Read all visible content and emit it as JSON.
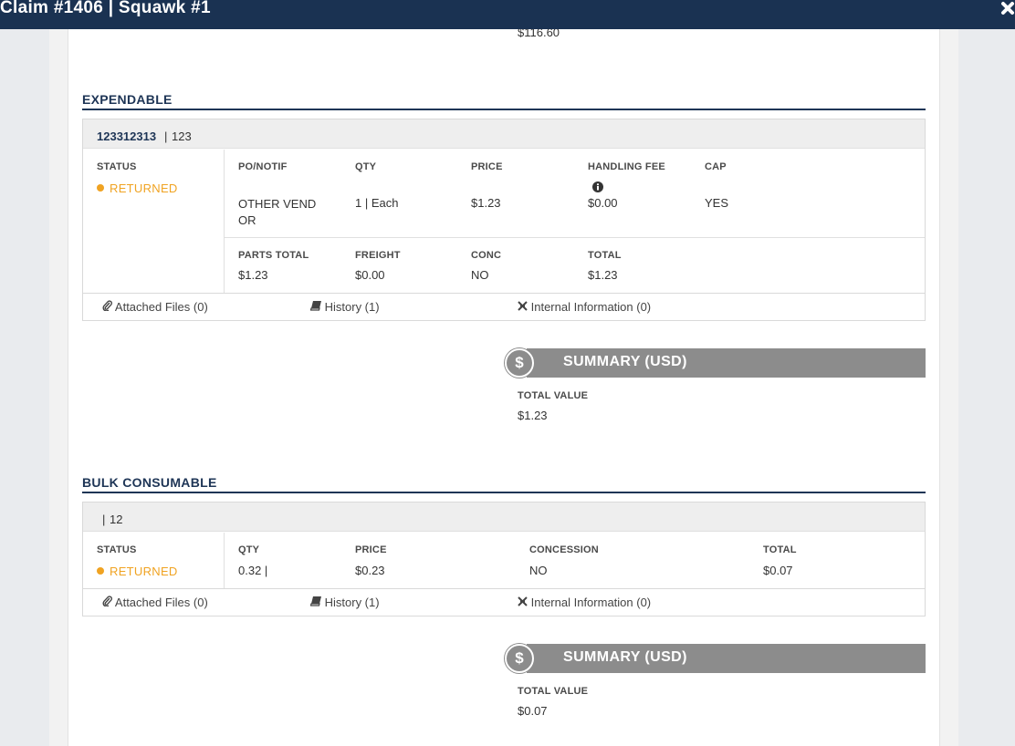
{
  "window": {
    "title": "Claim #1406 | Squawk #1"
  },
  "top_value": "$116.60",
  "sections": [
    {
      "title": "EXPENDABLE",
      "card": {
        "id": "123312313",
        "separator": "|",
        "sub": "123",
        "status_label": "STATUS",
        "status_value": "RETURNED",
        "row1": {
          "po_label": "PO/NOTIF",
          "po_value": "OTHER VENDOR",
          "qty_label": "QTY",
          "qty_value": "1 | Each",
          "price_label": "PRICE",
          "price_value": "$1.23",
          "fee_label": "HANDLING FEE",
          "fee_value": "$0.00",
          "cap_label": "CAP",
          "cap_value": "YES"
        },
        "row2": {
          "parts_label": "PARTS TOTAL",
          "parts_value": "$1.23",
          "freight_label": "FREIGHT",
          "freight_value": "$0.00",
          "conc_label": "CONC",
          "conc_value": "NO",
          "total_label": "TOTAL",
          "total_value": "$1.23"
        },
        "footer": {
          "files": "Attached Files (0)",
          "history": "History (1)",
          "internal": "Internal Information (0)"
        }
      },
      "summary": {
        "title": "SUMMARY (USD)",
        "total_label": "TOTAL VALUE",
        "total_value": "$1.23"
      }
    },
    {
      "title": "BULK CONSUMABLE",
      "card": {
        "separator": "|",
        "sub": "12",
        "status_label": "STATUS",
        "status_value": "RETURNED",
        "row1": {
          "qty_label": "QTY",
          "qty_value": "0.32 |",
          "price_label": "PRICE",
          "price_value": "$0.23",
          "concession_label": "CONCESSION",
          "concession_value": "NO",
          "total_label": "TOTAL",
          "total_value": "$0.07"
        },
        "footer": {
          "files": "Attached Files (0)",
          "history": "History (1)",
          "internal": "Internal Information (0)"
        }
      },
      "summary": {
        "title": "SUMMARY (USD)",
        "total_label": "TOTAL VALUE",
        "total_value": "$0.07"
      }
    }
  ],
  "icons": {
    "close": "close-icon",
    "dollar": "dollar-icon",
    "paperclip": "paperclip-icon",
    "book": "book-icon",
    "plane": "plane-icon",
    "info": "info-icon"
  },
  "colors": {
    "titlebar": "#1a3252",
    "section": "#1e3556",
    "status": "#f0a322",
    "summary": "#8c8c8c"
  }
}
